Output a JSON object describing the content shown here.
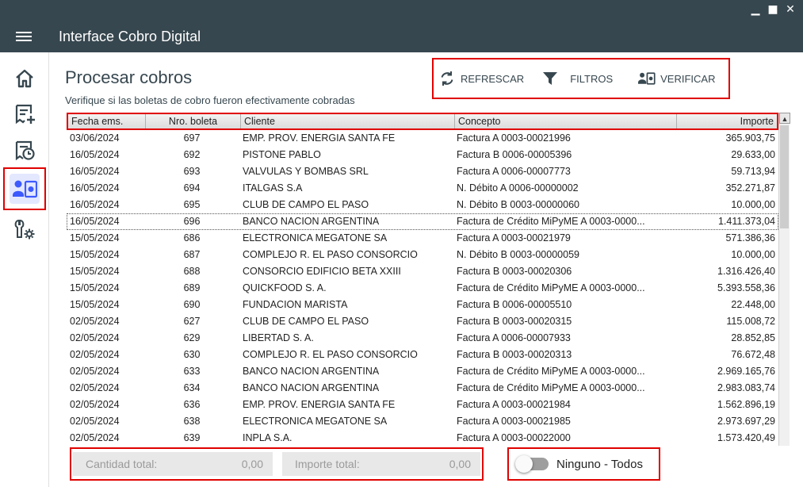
{
  "window": {
    "title": "Interface Cobro Digital",
    "minimize": "▁",
    "maximize": "■",
    "close": "✕"
  },
  "sidebar": {
    "items": [
      {
        "icon": "home-icon"
      },
      {
        "icon": "receipt-add-icon"
      },
      {
        "icon": "receipt-clock-icon"
      },
      {
        "icon": "verify-payments-icon",
        "active": true
      },
      {
        "icon": "tools-settings-icon"
      }
    ]
  },
  "page": {
    "title": "Procesar cobros",
    "subtitle": "Verifique si las boletas de cobro fueron efectivamente cobradas"
  },
  "toolbar": {
    "refresh_label": "REFRESCAR",
    "filters_label": "FILTROS",
    "verify_label": "VERIFICAR"
  },
  "table": {
    "headers": [
      "Fecha ems.",
      "Nro. boleta",
      "Cliente",
      "Concepto",
      "Importe"
    ],
    "rows": [
      [
        "03/06/2024",
        "697",
        "EMP. PROV. ENERGIA SANTA FE",
        "Factura A 0003-00021996",
        "365.903,75"
      ],
      [
        "16/05/2024",
        "692",
        "PISTONE PABLO",
        "Factura B 0006-00005396",
        "29.633,00"
      ],
      [
        "16/05/2024",
        "693",
        "VALVULAS Y BOMBAS SRL",
        "Factura A 0006-00007773",
        "59.713,94"
      ],
      [
        "16/05/2024",
        "694",
        "ITALGAS S.A",
        "N. Débito A 0006-00000002",
        "352.271,87"
      ],
      [
        "16/05/2024",
        "695",
        "CLUB DE CAMPO EL PASO",
        "N. Débito B 0003-00000060",
        "10.000,00"
      ],
      [
        "16/05/2024",
        "696",
        "BANCO NACION ARGENTINA",
        "Factura de Crédito MiPyME A 0003-0000...",
        "1.411.373,04"
      ],
      [
        "15/05/2024",
        "686",
        "ELECTRONICA MEGATONE SA",
        "Factura A 0003-00021979",
        "571.386,36"
      ],
      [
        "15/05/2024",
        "687",
        "COMPLEJO R. EL PASO CONSORCIO",
        "N. Débito B 0003-00000059",
        "10.000,00"
      ],
      [
        "15/05/2024",
        "688",
        "CONSORCIO EDIFICIO BETA XXIII",
        "Factura B 0003-00020306",
        "1.316.426,40"
      ],
      [
        "15/05/2024",
        "689",
        "QUICKFOOD S. A.",
        "Factura de Crédito MiPyME A 0003-0000...",
        "5.393.558,36"
      ],
      [
        "15/05/2024",
        "690",
        "FUNDACION MARISTA",
        "Factura B 0006-00005510",
        "22.448,00"
      ],
      [
        "02/05/2024",
        "627",
        "CLUB DE CAMPO EL PASO",
        "Factura B 0003-00020315",
        "115.008,72"
      ],
      [
        "02/05/2024",
        "629",
        "LIBERTAD S. A.",
        "Factura A 0006-00007933",
        "28.852,85"
      ],
      [
        "02/05/2024",
        "630",
        "COMPLEJO R. EL PASO CONSORCIO",
        "Factura B 0003-00020313",
        "76.672,48"
      ],
      [
        "02/05/2024",
        "633",
        "BANCO NACION ARGENTINA",
        "Factura de Crédito MiPyME A 0003-0000...",
        "2.969.165,76"
      ],
      [
        "02/05/2024",
        "634",
        "BANCO NACION ARGENTINA",
        "Factura de Crédito MiPyME A 0003-0000...",
        "2.983.083,74"
      ],
      [
        "02/05/2024",
        "636",
        "EMP. PROV. ENERGIA SANTA FE",
        "Factura A 0003-00021984",
        "1.562.896,19"
      ],
      [
        "02/05/2024",
        "638",
        "ELECTRONICA MEGATONE SA",
        "Factura A 0003-00021985",
        "2.973.697,29"
      ],
      [
        "02/05/2024",
        "639",
        "INPLA S.A.",
        "Factura A 0003-00022000",
        "1.573.420,49"
      ]
    ],
    "selected_row": 5,
    "scroll_up": "▲"
  },
  "totals": {
    "count_label": "Cantidad total:",
    "count_value": "0,00",
    "amount_label": "Importe total:",
    "amount_value": "0,00"
  },
  "toggle": {
    "label": "Ninguno - Todos",
    "checked": false
  }
}
